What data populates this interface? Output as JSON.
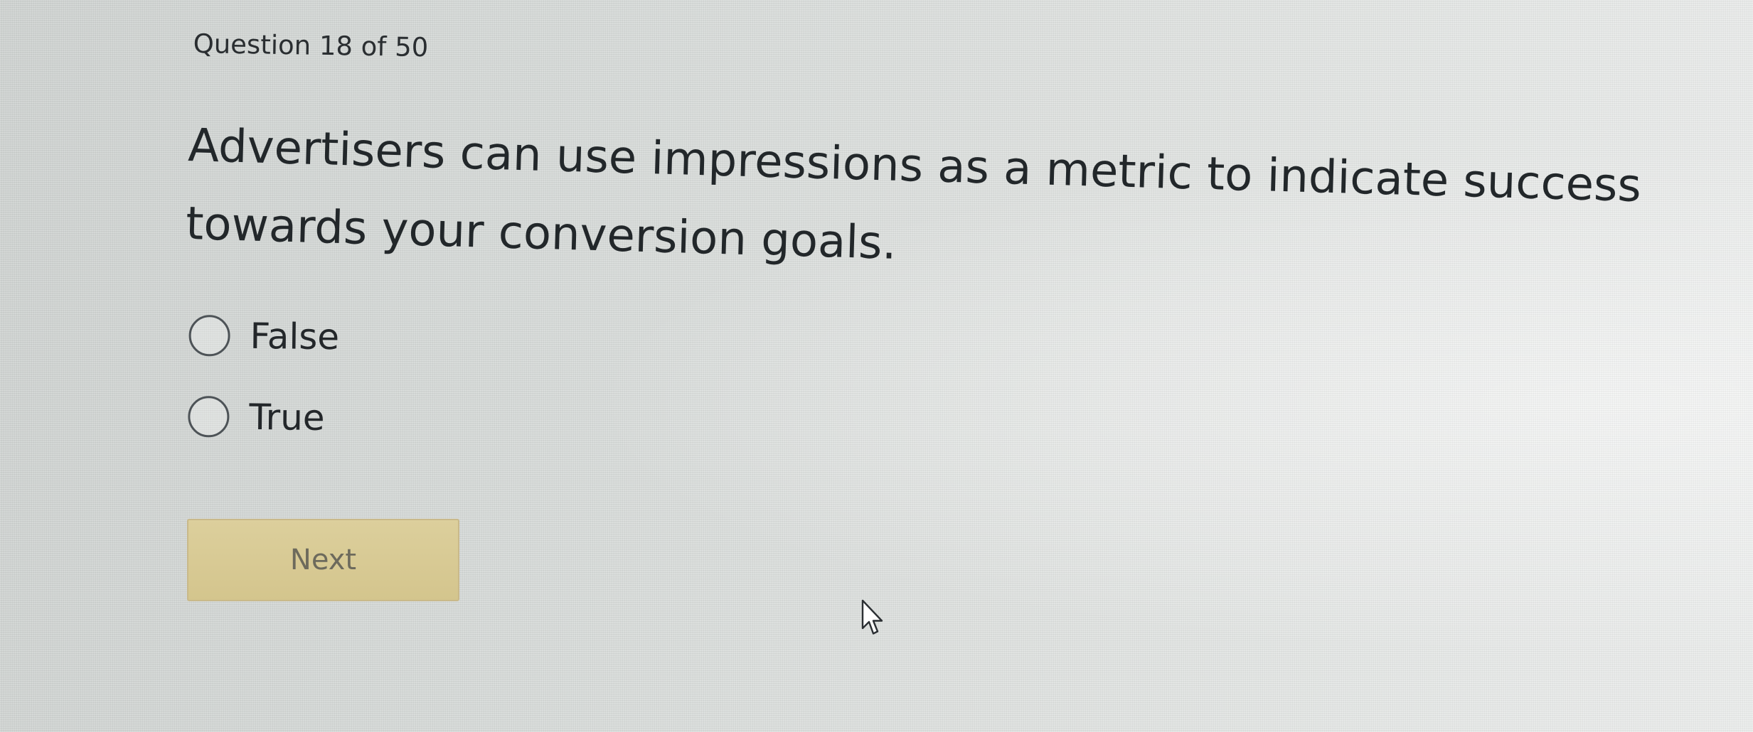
{
  "quiz": {
    "counter": "Question 18 of 50",
    "question": "Advertisers can use impressions as a metric to indicate success towards your conversion goals.",
    "options": [
      {
        "label": "False",
        "selected": false
      },
      {
        "label": "True",
        "selected": false
      }
    ],
    "next_label": "Next"
  },
  "colors": {
    "next_button_bg": "#d8ca95",
    "next_button_text": "#6d6a5c"
  },
  "icons": {
    "cursor": "mouse-pointer-icon"
  }
}
